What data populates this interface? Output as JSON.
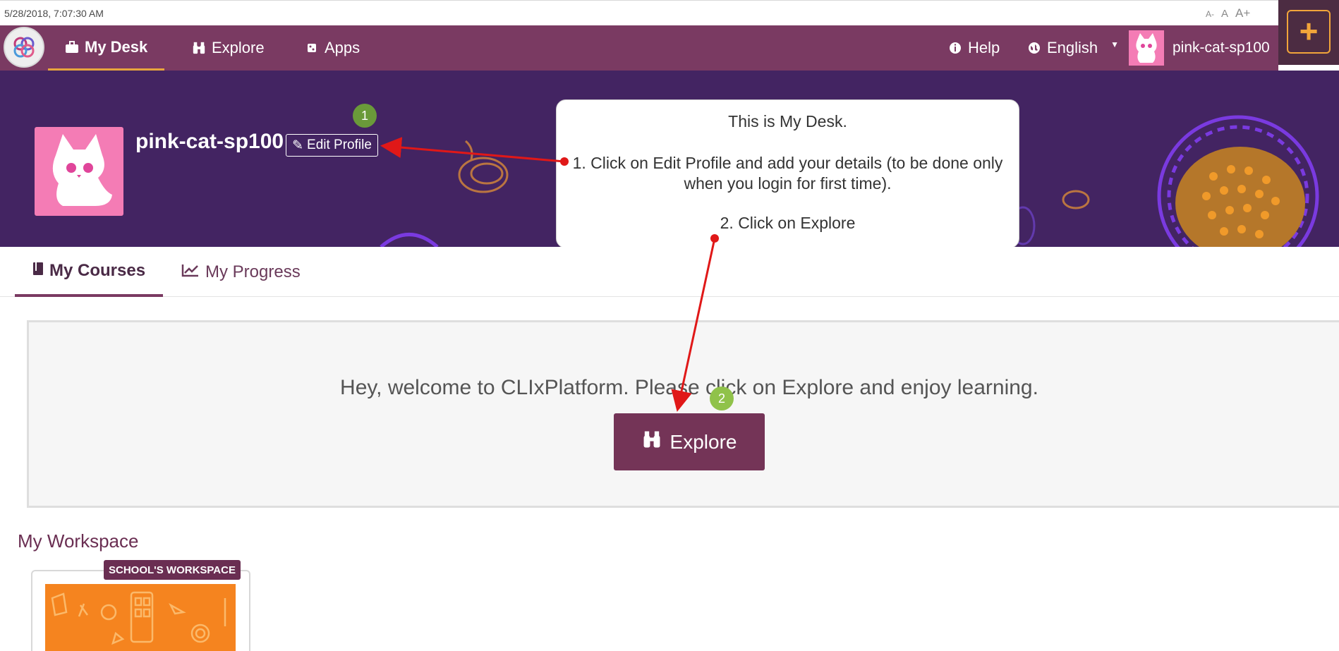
{
  "topbar": {
    "timestamp": "5/28/2018, 7:07:30 AM",
    "font_small": "A-",
    "font_normal": "A",
    "font_large": "A+"
  },
  "nav": {
    "items": [
      {
        "label": "My Desk",
        "icon": "briefcase-icon"
      },
      {
        "label": "Explore",
        "icon": "binoculars-icon"
      },
      {
        "label": "Apps",
        "icon": "apps-icon"
      }
    ],
    "help_label": "Help",
    "language_label": "English",
    "username": "pink-cat-sp100",
    "plus_label": "+"
  },
  "profile": {
    "name": "pink-cat-sp100",
    "edit_label": "Edit Profile"
  },
  "callout": {
    "line1": "This is My Desk.",
    "line2": "1. Click on Edit Profile and add your details (to be done only when you login for first time).",
    "line3": "2. Click on Explore"
  },
  "markers": {
    "m1": "1",
    "m2": "2"
  },
  "tabs": [
    {
      "label": "My Courses",
      "icon": "book-icon"
    },
    {
      "label": "My Progress",
      "icon": "line-chart-icon"
    }
  ],
  "welcome": {
    "message": "Hey, welcome to CLIxPlatform. Please click on Explore and enjoy learning.",
    "button_label": "Explore"
  },
  "workspace": {
    "title": "My Workspace",
    "badge": "SCHOOL'S WORKSPACE"
  },
  "colors": {
    "nav": "#7a3a62",
    "banner": "#432462",
    "accent": "#e8a53d",
    "button": "#743457"
  }
}
